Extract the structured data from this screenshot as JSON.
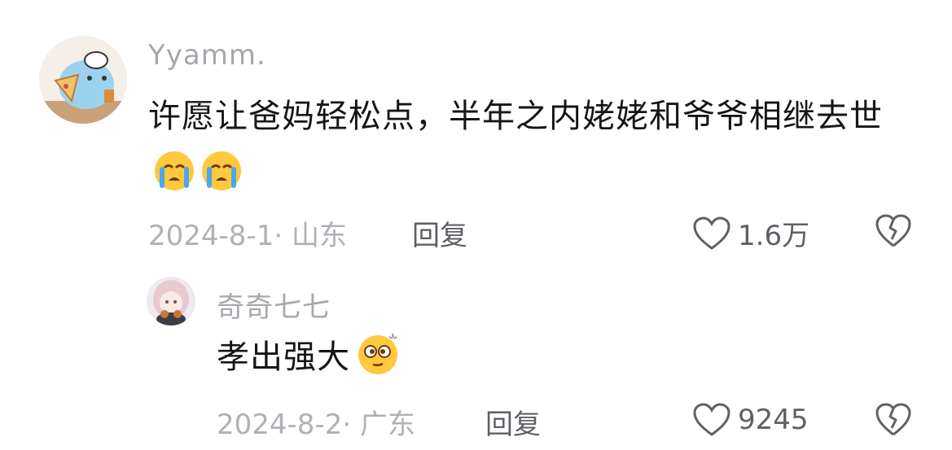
{
  "comments": [
    {
      "username": "Yyamm.",
      "text": "许愿让爸妈轻松点，半年之内姥姥和爷爷相继去世",
      "emojis": [
        "crying-face-emoji",
        "crying-face-emoji"
      ],
      "meta": "2024-8-1· 山东",
      "reply_label": "回复",
      "like_count": "1.6万"
    },
    {
      "username": "奇奇七七",
      "text": "孝出强大",
      "emojis": [
        "dizzy-face-emoji"
      ],
      "meta": "2024-8-2· 广东",
      "reply_label": "回复",
      "like_count": "9245"
    }
  ],
  "colors": {
    "username": "#a7a7ad",
    "meta": "#b0b0b6",
    "action": "#5f5f66",
    "text": "#161616"
  }
}
